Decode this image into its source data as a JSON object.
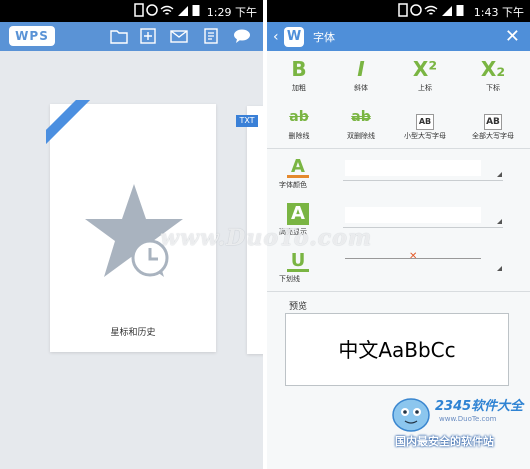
{
  "left": {
    "status_time": "1:29 下午",
    "app_logo": "WPS",
    "toolbar": [
      "folder-icon",
      "new-doc-icon",
      "mail-icon",
      "document-icon",
      "chat-icon"
    ],
    "card_label": "星标和历史",
    "peek_badge": "TXT"
  },
  "right": {
    "status_time": "1:43 下午",
    "title": "字体",
    "format_buttons": [
      {
        "glyph": "B",
        "label": "加粗"
      },
      {
        "glyph": "I",
        "label": "斜体"
      },
      {
        "glyph": "X²",
        "label": "上标"
      },
      {
        "glyph": "X₂",
        "label": "下标"
      },
      {
        "glyph": "ab",
        "label": "删除线"
      },
      {
        "glyph": "ab",
        "label": "双删除线"
      },
      {
        "glyph": "AB",
        "label": "小型大写字母"
      },
      {
        "glyph": "AB",
        "label": "全部大写字母"
      }
    ],
    "props": [
      {
        "icon": "A",
        "label": "字体颜色"
      },
      {
        "icon": "A",
        "label": "高亮显示"
      },
      {
        "icon": "U",
        "label": "下划线"
      }
    ],
    "preview_label": "预览",
    "preview_text": "中文AaBbCc"
  },
  "watermark": "www.DuoTo.com",
  "badge": {
    "name": "2345软件大全",
    "url": "www.DuoTe.com",
    "slogan": "国内最安全的软件站"
  },
  "colors": {
    "accent": "#4f8fd9",
    "green": "#7ab543"
  }
}
